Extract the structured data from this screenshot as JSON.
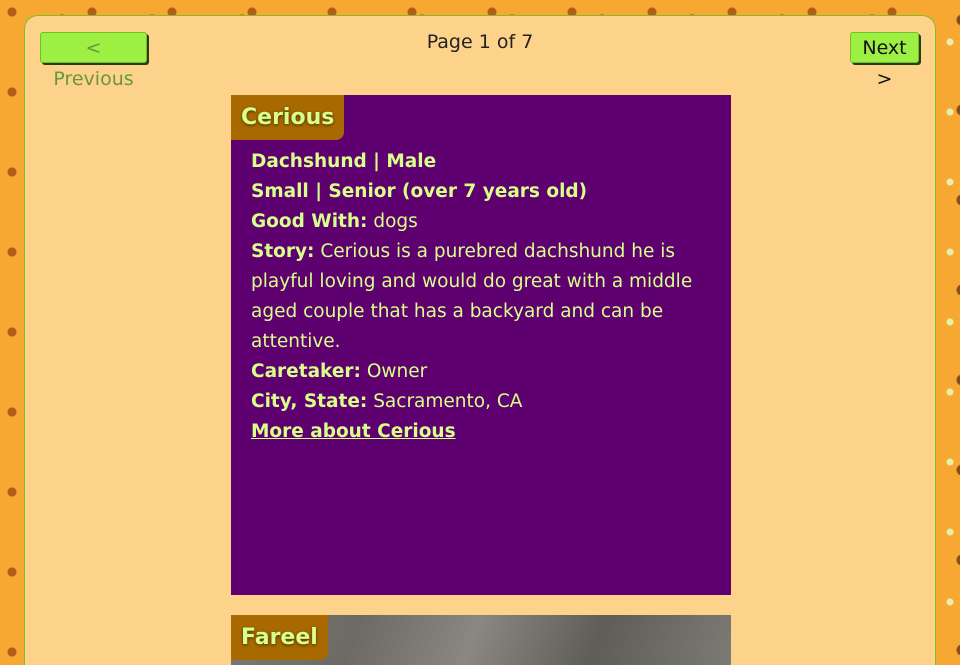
{
  "pagination": {
    "prev_label": "< Previous",
    "next_label": "Next >",
    "page_text": "Page 1 of 7"
  },
  "pets": [
    {
      "name": "Cerious",
      "breed_gender": "Dachshund | Male",
      "size_age": "Small | Senior (over 7 years old)",
      "good_with_label": "Good With:",
      "good_with": "dogs",
      "story_label": "Story:",
      "story": "Cerious is a purebred dachshund he is playful loving and would do great with a middle aged couple that has a backyard and can be attentive.",
      "caretaker_label": "Caretaker:",
      "caretaker": "Owner",
      "city_label": "City, State:",
      "city": "Sacramento, CA",
      "more_link": "More about Cerious"
    },
    {
      "name": "Fareel"
    }
  ],
  "colors": {
    "page_background": "#f7a833",
    "panel": "#fdd38c",
    "button": "#9df043",
    "card_purple": "#5f0070",
    "name_tab": "#a86a00",
    "text_lime": "#d7ff8a"
  }
}
